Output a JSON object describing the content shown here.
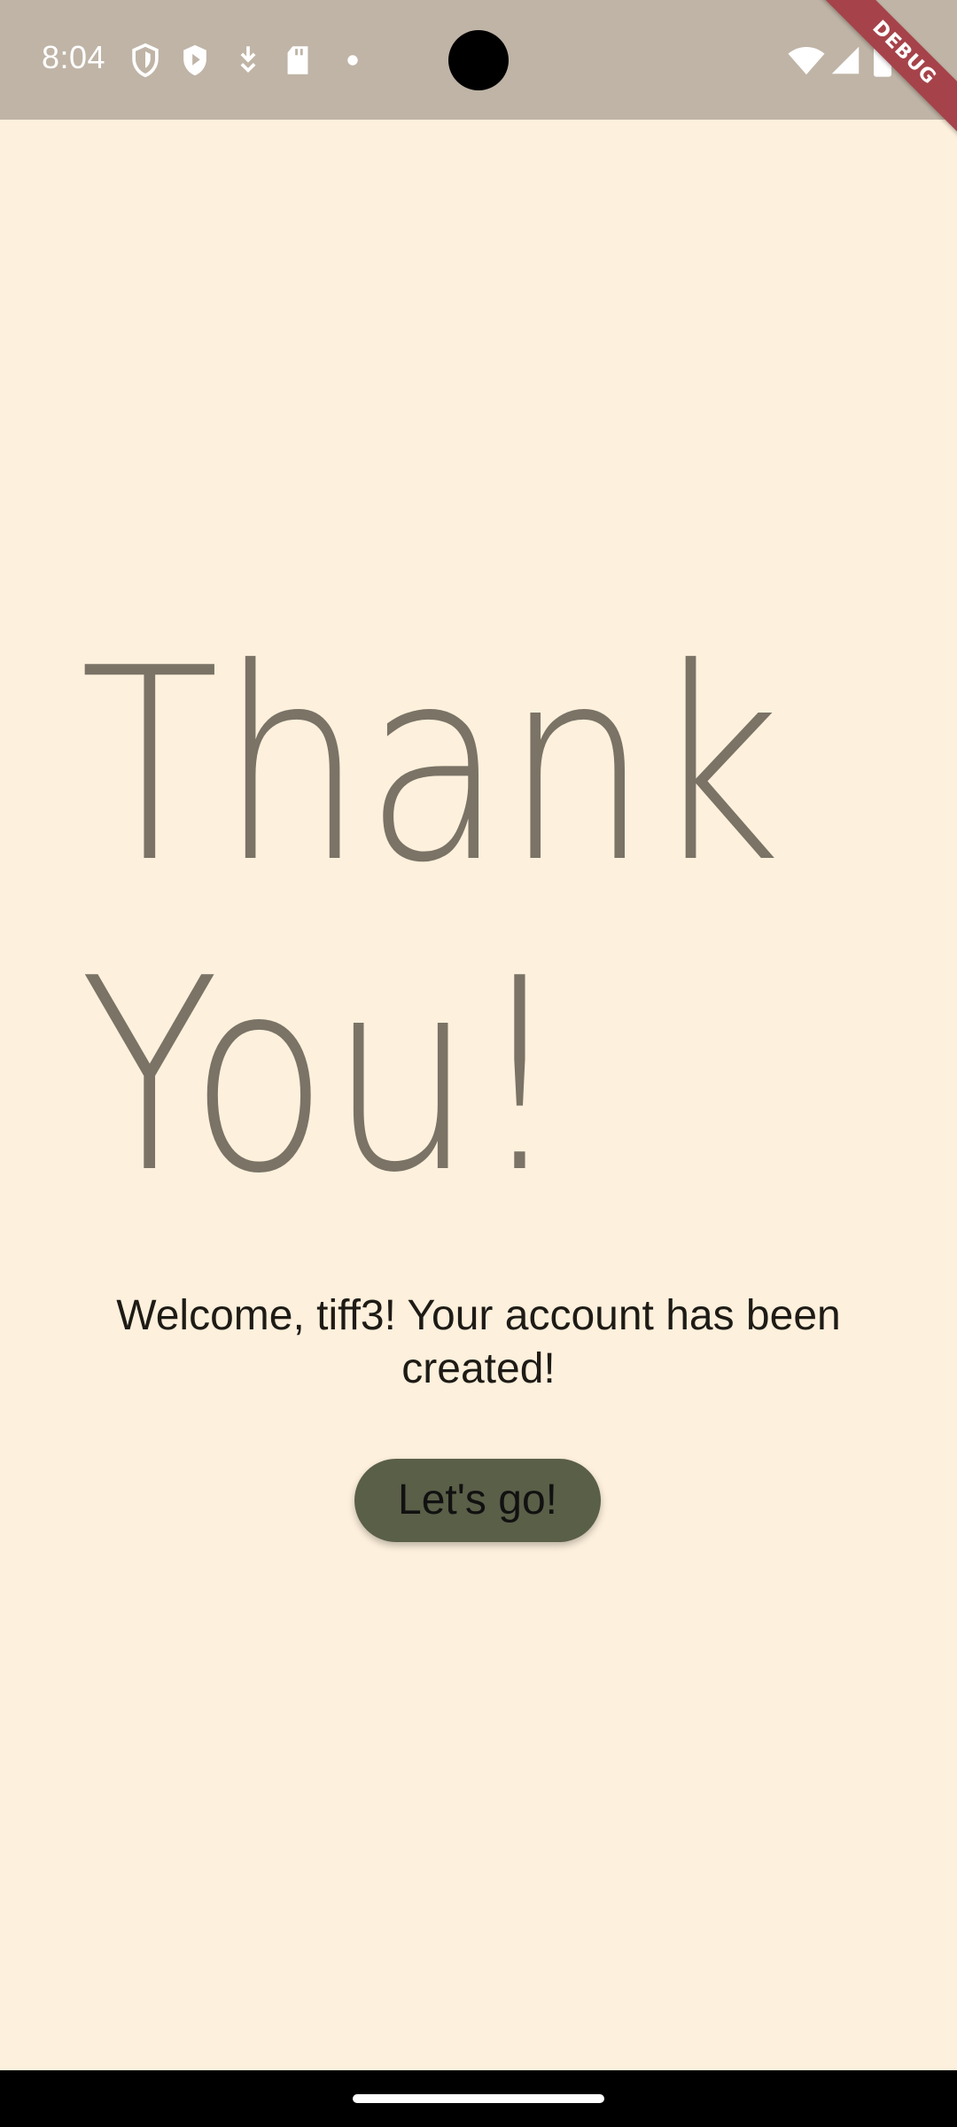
{
  "status_bar": {
    "time": "8:04",
    "left_icons": [
      "shield-outline-icon",
      "play-shield-icon",
      "download-icon",
      "sd-card-icon",
      "dot-icon"
    ],
    "right_icons": [
      "wifi-icon",
      "signal-icon",
      "battery-icon"
    ],
    "debug_label": "DEBUG",
    "background": "#BFB4A6"
  },
  "main": {
    "headline_line1": "Thank",
    "headline_line2": "You!",
    "welcome_text": "Welcome, tiff3! Your account has been created!",
    "button_label": "Let's go!",
    "background": "#FDF0DC",
    "headline_color": "#7A7366",
    "button_color": "#5A5F48"
  }
}
